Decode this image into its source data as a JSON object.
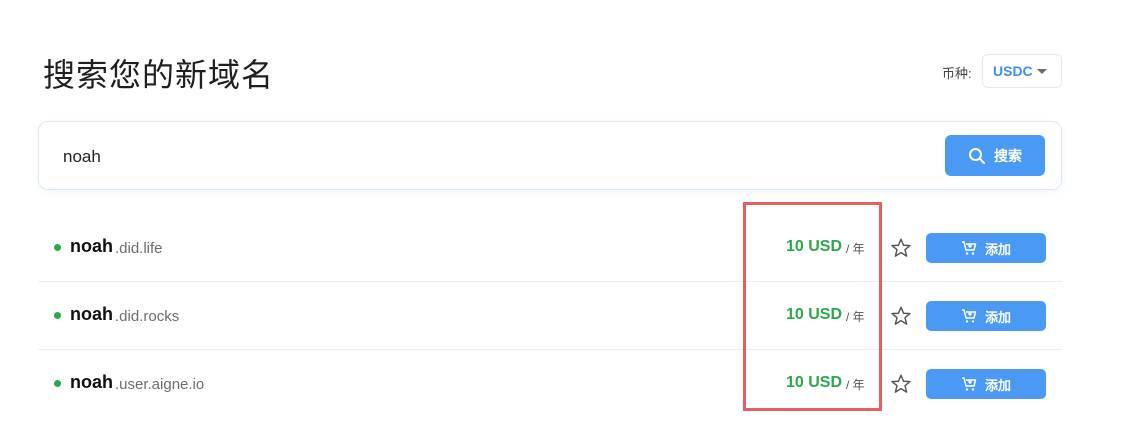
{
  "title": "搜索您的新域名",
  "currency": {
    "label": "币种:",
    "selected": "USDC"
  },
  "search": {
    "value": "noah",
    "button_label": "搜索"
  },
  "results": [
    {
      "name": "noah",
      "suffix": ".did.life",
      "price": "10 USD",
      "per": "/ 年",
      "add_label": "添加"
    },
    {
      "name": "noah",
      "suffix": ".did.rocks",
      "price": "10 USD",
      "per": "/ 年",
      "add_label": "添加"
    },
    {
      "name": "noah",
      "suffix": ".user.aigne.io",
      "price": "10 USD",
      "per": "/ 年",
      "add_label": "添加"
    }
  ],
  "colors": {
    "accent": "#4a9af5",
    "available": "#2aa84a",
    "highlight": "#e85e5e"
  },
  "icons": {
    "search": "search-icon",
    "star": "star-icon",
    "cart": "cart-icon",
    "caret": "chevron-down-icon",
    "status": "available-dot-icon"
  }
}
